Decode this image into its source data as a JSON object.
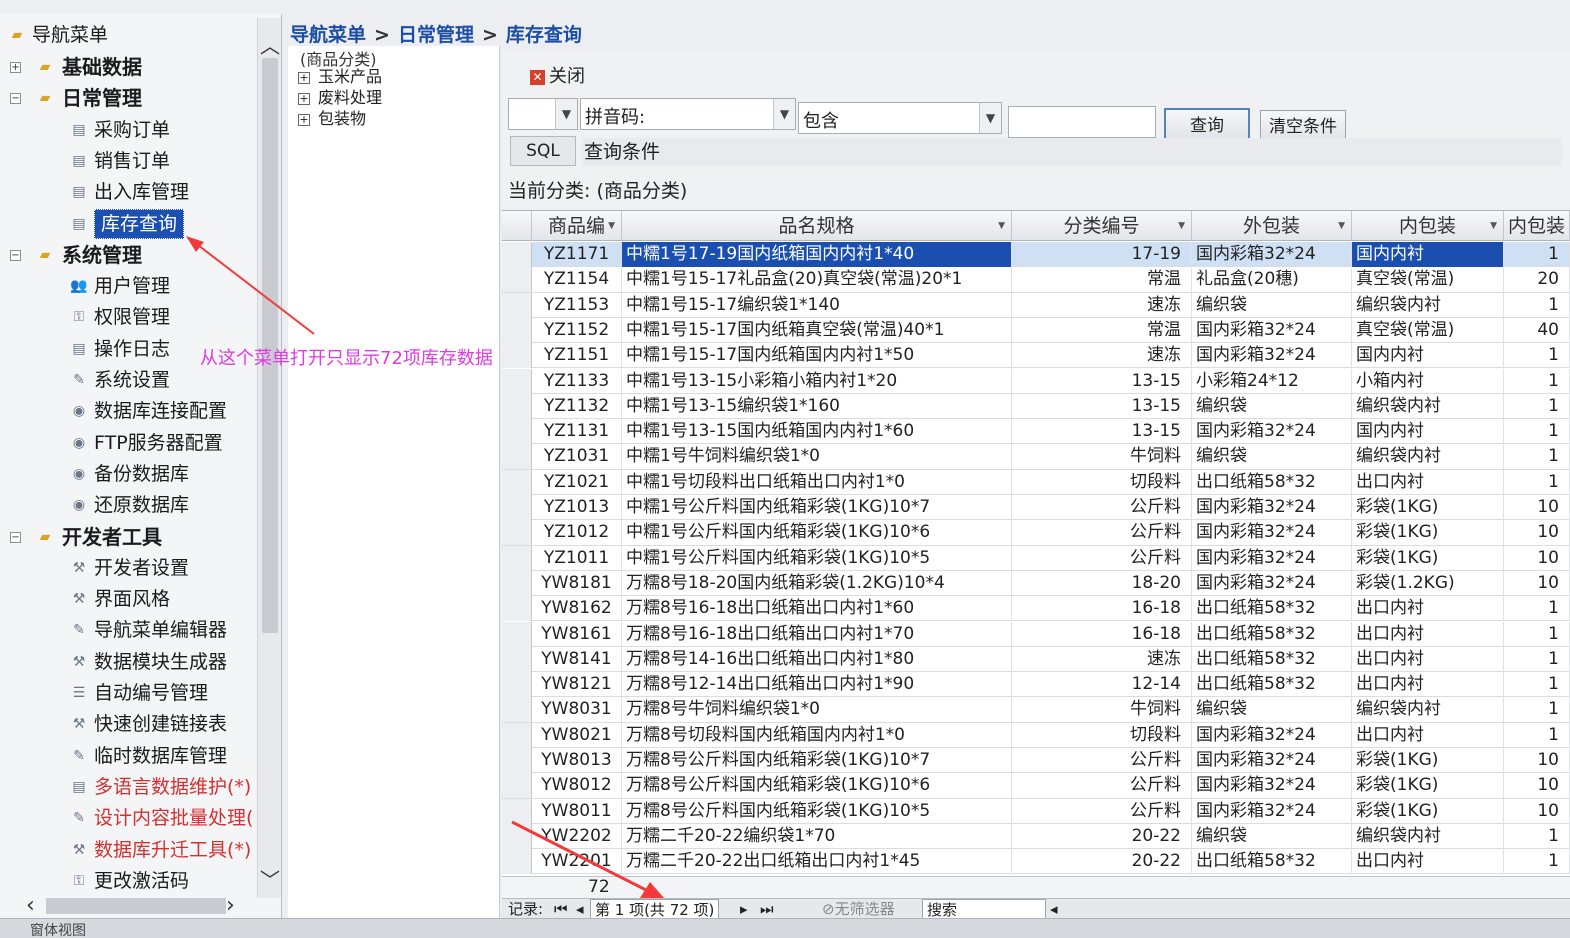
{
  "nav": {
    "root": "导航菜单",
    "items": [
      {
        "label": "基础数据",
        "level": 1,
        "type": "folder",
        "exp": "+"
      },
      {
        "label": "日常管理",
        "level": 1,
        "type": "folder",
        "exp": "−"
      },
      {
        "label": "采购订单",
        "level": 2,
        "type": "doc"
      },
      {
        "label": "销售订单",
        "level": 2,
        "type": "doc"
      },
      {
        "label": "出入库管理",
        "level": 2,
        "type": "doc"
      },
      {
        "label": "库存查询",
        "level": 2,
        "type": "doc",
        "selected": true
      },
      {
        "label": "系统管理",
        "level": 1,
        "type": "folder",
        "exp": "−"
      },
      {
        "label": "用户管理",
        "level": 2,
        "type": "users"
      },
      {
        "label": "权限管理",
        "level": 2,
        "type": "key"
      },
      {
        "label": "操作日志",
        "level": 2,
        "type": "doc"
      },
      {
        "label": "系统设置",
        "level": 2,
        "type": "edit"
      },
      {
        "label": "数据库连接配置",
        "level": 2,
        "type": "db"
      },
      {
        "label": "FTP服务器配置",
        "level": 2,
        "type": "db"
      },
      {
        "label": "备份数据库",
        "level": 2,
        "type": "db"
      },
      {
        "label": "还原数据库",
        "level": 2,
        "type": "db"
      },
      {
        "label": "开发者工具",
        "level": 1,
        "type": "folder",
        "exp": "−"
      },
      {
        "label": "开发者设置",
        "level": 2,
        "type": "tool"
      },
      {
        "label": "界面风格",
        "level": 2,
        "type": "tool"
      },
      {
        "label": "导航菜单编辑器",
        "level": 2,
        "type": "edit"
      },
      {
        "label": "数据模块生成器",
        "level": 2,
        "type": "tool"
      },
      {
        "label": "自动编号管理",
        "level": 2,
        "type": "list"
      },
      {
        "label": "快速创建链接表",
        "level": 2,
        "type": "tool"
      },
      {
        "label": "临时数据库管理",
        "level": 2,
        "type": "edit"
      },
      {
        "label": "多语言数据维护(*)",
        "level": 2,
        "type": "doc",
        "red": true
      },
      {
        "label": "设计内容批量处理(",
        "level": 2,
        "type": "edit",
        "red": true
      },
      {
        "label": "数据库升迁工具(*)",
        "level": 2,
        "type": "tool",
        "red": true
      },
      {
        "label": "更改激活码",
        "level": 2,
        "type": "key"
      }
    ]
  },
  "breadcrumb": [
    "导航菜单",
    "日常管理",
    "库存查询"
  ],
  "breadcrumb_sep": ">",
  "category_tree": {
    "title": "(商品分类)",
    "items": [
      "玉米产品",
      "废料处理",
      "包装物"
    ]
  },
  "toolbar": {
    "close_label": "关闭",
    "field_combo": "",
    "pinyin_label": "拼音码:",
    "match_combo": "包含",
    "query_value": "",
    "query_button": "查询",
    "clear_button": "清空条件",
    "sql_button": "SQL",
    "condition_label": "查询条件",
    "current_category": "当前分类: (商品分类)"
  },
  "grid": {
    "columns": [
      "商品编",
      "品名规格",
      "分类编号",
      "外包装",
      "内包装",
      "内包装"
    ],
    "rows": [
      [
        "YZ1171",
        "中糯1号17-19国内纸箱国内内衬1*40",
        "17-19",
        "国内彩箱32*24",
        "国内内衬",
        "1"
      ],
      [
        "YZ1154",
        "中糯1号15-17礼品盒(20)真空袋(常温)20*1",
        "常温",
        "礼品盒(20穗)",
        "真空袋(常温)",
        "20"
      ],
      [
        "YZ1153",
        "中糯1号15-17编织袋1*140",
        "速冻",
        "编织袋",
        "编织袋内衬",
        "1"
      ],
      [
        "YZ1152",
        "中糯1号15-17国内纸箱真空袋(常温)40*1",
        "常温",
        "国内彩箱32*24",
        "真空袋(常温)",
        "40"
      ],
      [
        "YZ1151",
        "中糯1号15-17国内纸箱国内内衬1*50",
        "速冻",
        "国内彩箱32*24",
        "国内内衬",
        "1"
      ],
      [
        "YZ1133",
        "中糯1号13-15小彩箱小箱内衬1*20",
        "13-15",
        "小彩箱24*12",
        "小箱内衬",
        "1"
      ],
      [
        "YZ1132",
        "中糯1号13-15编织袋1*160",
        "13-15",
        "编织袋",
        "编织袋内衬",
        "1"
      ],
      [
        "YZ1131",
        "中糯1号13-15国内纸箱国内内衬1*60",
        "13-15",
        "国内彩箱32*24",
        "国内内衬",
        "1"
      ],
      [
        "YZ1031",
        "中糯1号牛饲料编织袋1*0",
        "牛饲料",
        "编织袋",
        "编织袋内衬",
        "1"
      ],
      [
        "YZ1021",
        "中糯1号切段料出口纸箱出口内衬1*0",
        "切段料",
        "出口纸箱58*32",
        "出口内衬",
        "1"
      ],
      [
        "YZ1013",
        "中糯1号公斤料国内纸箱彩袋(1KG)10*7",
        "公斤料",
        "国内彩箱32*24",
        "彩袋(1KG)",
        "10"
      ],
      [
        "YZ1012",
        "中糯1号公斤料国内纸箱彩袋(1KG)10*6",
        "公斤料",
        "国内彩箱32*24",
        "彩袋(1KG)",
        "10"
      ],
      [
        "YZ1011",
        "中糯1号公斤料国内纸箱彩袋(1KG)10*5",
        "公斤料",
        "国内彩箱32*24",
        "彩袋(1KG)",
        "10"
      ],
      [
        "YW8181",
        "万糯8号18-20国内纸箱彩袋(1.2KG)10*4",
        "18-20",
        "国内彩箱32*24",
        "彩袋(1.2KG)",
        "10"
      ],
      [
        "YW8162",
        "万糯8号16-18出口纸箱出口内衬1*60",
        "16-18",
        "出口纸箱58*32",
        "出口内衬",
        "1"
      ],
      [
        "YW8161",
        "万糯8号16-18出口纸箱出口内衬1*70",
        "16-18",
        "出口纸箱58*32",
        "出口内衬",
        "1"
      ],
      [
        "YW8141",
        "万糯8号14-16出口纸箱出口内衬1*80",
        "速冻",
        "出口纸箱58*32",
        "出口内衬",
        "1"
      ],
      [
        "YW8121",
        "万糯8号12-14出口纸箱出口内衬1*90",
        "12-14",
        "出口纸箱58*32",
        "出口内衬",
        "1"
      ],
      [
        "YW8031",
        "万糯8号牛饲料编织袋1*0",
        "牛饲料",
        "编织袋",
        "编织袋内衬",
        "1"
      ],
      [
        "YW8021",
        "万糯8号切段料国内纸箱国内内衬1*0",
        "切段料",
        "国内彩箱32*24",
        "出口内衬",
        "1"
      ],
      [
        "YW8013",
        "万糯8号公斤料国内纸箱彩袋(1KG)10*7",
        "公斤料",
        "国内彩箱32*24",
        "彩袋(1KG)",
        "10"
      ],
      [
        "YW8012",
        "万糯8号公斤料国内纸箱彩袋(1KG)10*6",
        "公斤料",
        "国内彩箱32*24",
        "彩袋(1KG)",
        "10"
      ],
      [
        "YW8011",
        "万糯8号公斤料国内纸箱彩袋(1KG)10*5",
        "公斤料",
        "国内彩箱32*24",
        "彩袋(1KG)",
        "10"
      ],
      [
        "YW2202",
        "万糯二千20-22编织袋1*70",
        "20-22",
        "编织袋",
        "编织袋内衬",
        "1"
      ],
      [
        "YW2201",
        "万糯二千20-22出口纸箱出口内衬1*45",
        "20-22",
        "出口纸箱58*32",
        "出口内衬",
        "1"
      ]
    ],
    "footer_count": "72"
  },
  "record_nav": {
    "label": "记录:",
    "position": "第 1 项(共 72 项)",
    "filter": "无筛选器",
    "search": "搜索"
  },
  "annotation": "从这个菜单打开只显示72项库存数据",
  "status_bar": "窗体视图",
  "colors": {
    "selection": "#1a4fb0",
    "annotation": "#e238e5",
    "arrow": "#f23a3a",
    "breadcrumb": "#1d4ea6"
  }
}
